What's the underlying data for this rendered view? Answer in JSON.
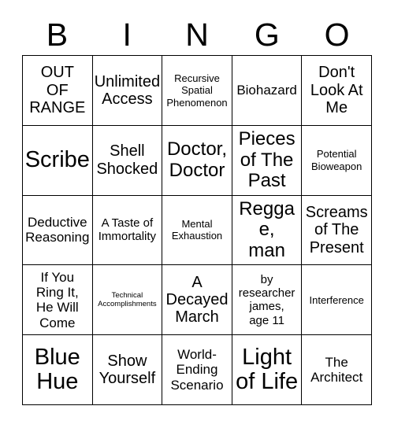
{
  "header": {
    "letters": [
      "B",
      "I",
      "N",
      "G",
      "O"
    ]
  },
  "colors": {
    "background": "#ffffff",
    "text": "#000000",
    "border": "#000000"
  },
  "grid": {
    "rows": 5,
    "columns": 5,
    "cells": [
      {
        "text": "OUT\nOF\nRANGE",
        "size": "l"
      },
      {
        "text": "Unlimited\nAccess",
        "size": "l"
      },
      {
        "text": "Recursive\nSpatial\nPhenomenon",
        "size": "xs"
      },
      {
        "text": "Biohazard",
        "size": "m"
      },
      {
        "text": "Don't\nLook At\nMe",
        "size": "l"
      },
      {
        "text": "Scribe",
        "size": "xxl"
      },
      {
        "text": "Shell\nShocked",
        "size": "l"
      },
      {
        "text": "Doctor,\nDoctor",
        "size": "xl"
      },
      {
        "text": "Pieces\nof The\nPast",
        "size": "xl"
      },
      {
        "text": "Potential\nBioweapon",
        "size": "xs"
      },
      {
        "text": "Deductive\nReasoning",
        "size": "m"
      },
      {
        "text": "A Taste of\nImmortality",
        "size": "s"
      },
      {
        "text": "Mental\nExhaustion",
        "size": "xs"
      },
      {
        "text": "Reggae,\nman",
        "size": "xl"
      },
      {
        "text": "Screams\nof The\nPresent",
        "size": "l"
      },
      {
        "text": "If You\nRing It,\nHe Will\nCome",
        "size": "m"
      },
      {
        "text": "Technical\nAccomplishments",
        "size": "xxs"
      },
      {
        "text": "A\nDecayed\nMarch",
        "size": "l"
      },
      {
        "text": "by\nresearcher\njames,\nage 11",
        "size": "s"
      },
      {
        "text": "Interference",
        "size": "xs"
      },
      {
        "text": "Blue\nHue",
        "size": "xxl"
      },
      {
        "text": "Show\nYourself",
        "size": "l"
      },
      {
        "text": "World-\nEnding\nScenario",
        "size": "m"
      },
      {
        "text": "Light\nof Life",
        "size": "xxl"
      },
      {
        "text": "The\nArchitect",
        "size": "m"
      }
    ]
  }
}
